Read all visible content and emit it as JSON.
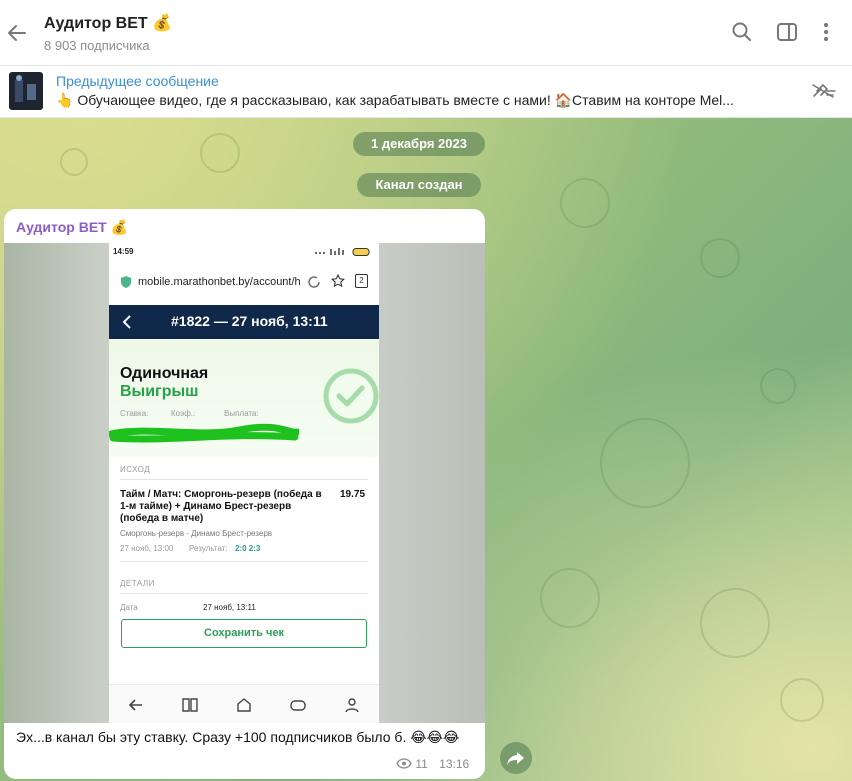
{
  "header": {
    "title": "Аудитор BET",
    "title_emoji": "💰",
    "subtitle": "8 903 подписчика"
  },
  "pinned": {
    "title": "Предыдущее сообщение",
    "text": "👆 Обучающее видео, где я рассказываю, как зарабатывать вместе с нами! 🏠Ставим на конторе Mel..."
  },
  "chat": {
    "date_pill": "1 декабря 2023",
    "service_pill": "Канал создан"
  },
  "message": {
    "sender": "Аудитор BET",
    "sender_emoji": "💰",
    "text": "Эх...в канал бы эту ставку. Сразу +100 подписчиков было б. 😂😂😂",
    "views": "11",
    "time": "13:16",
    "screenshot": {
      "status_time": "14:59",
      "url": "mobile.marathonbet.by/account/h",
      "tab_count": "2",
      "nav_title": "#1822 — 27 нояб, 13:11",
      "bet_type": "Одиночная",
      "result": "Выигрыш",
      "stake_label": "Ставка:",
      "coef_label": "Коэф.:",
      "payout_label": "Выплата:",
      "section_outcome": "ИСХОД",
      "event": "Тайм / Матч: Сморгонь-резерв (победа в 1-м тайме) + Динамо Брест-резерв (победа в матче)",
      "odds": "19.75",
      "teams": "Сморгонь-резерв - Динамо Брест-резерв",
      "match_date": "27 нояб, 13:00",
      "result_label": "Результат:",
      "score": "2:0 2:3",
      "section_details": "ДЕТАЛИ",
      "date_label": "Дата",
      "date_value": "27 нояб, 13:11",
      "save_button": "Сохранить чек"
    }
  },
  "colors": {
    "accent": "#3a8fd9",
    "sender": "#8f5dc7",
    "win": "#26a24a",
    "nav": "#10294a"
  }
}
